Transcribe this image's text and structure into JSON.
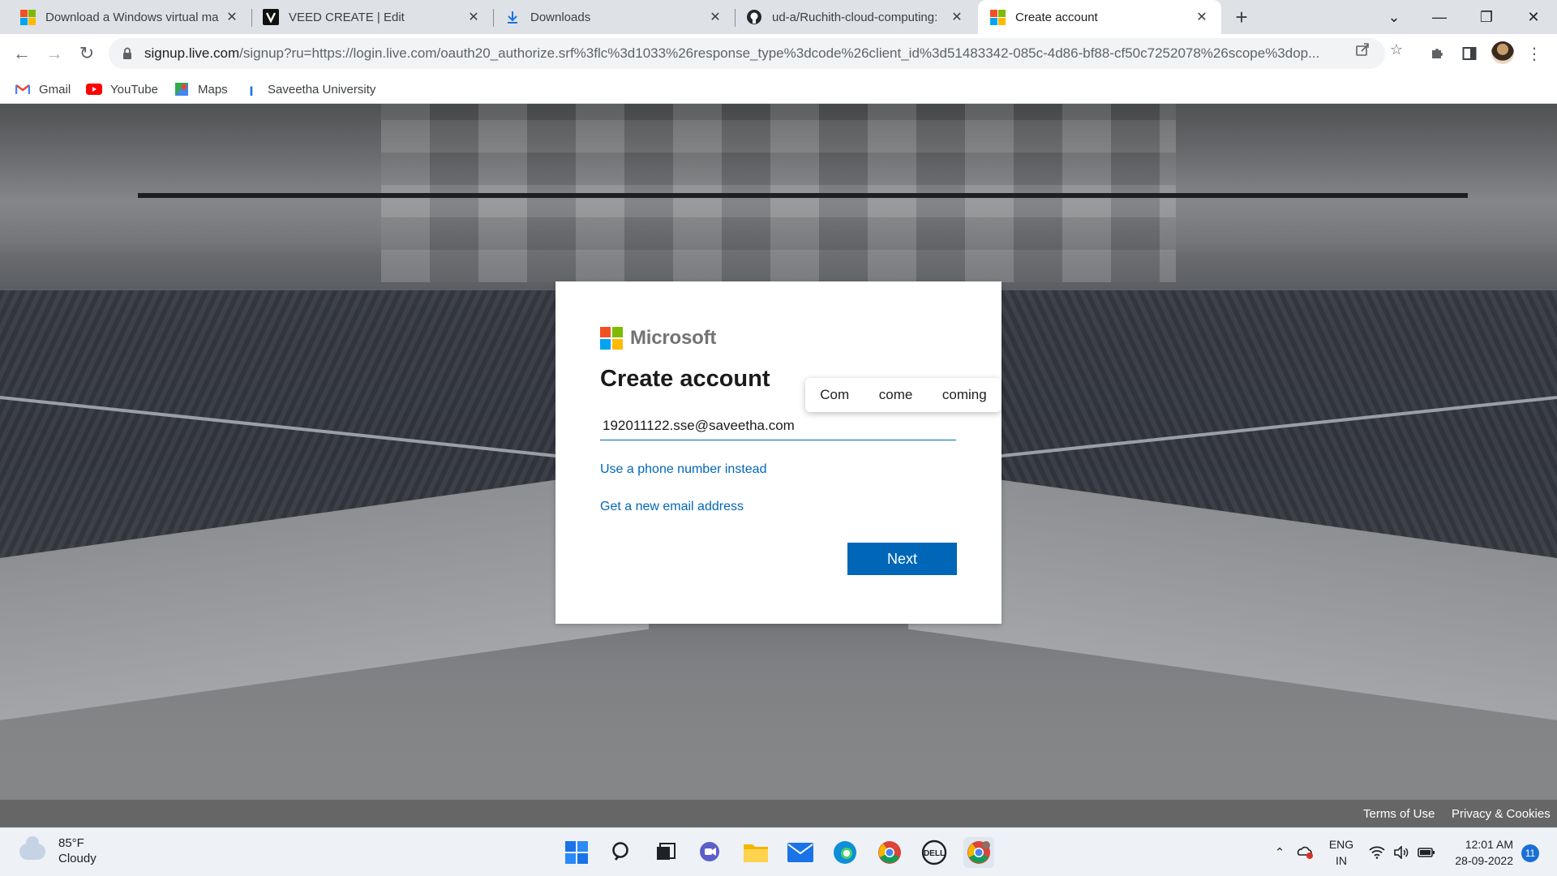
{
  "browser": {
    "tabs": [
      {
        "title": "Download a Windows virtual ma",
        "icon": "windows-logo-icon"
      },
      {
        "title": "VEED CREATE | Edit",
        "icon": "veed-logo-icon"
      },
      {
        "title": "Downloads",
        "icon": "download-icon"
      },
      {
        "title": "ud-a/Ruchith-cloud-computing:",
        "icon": "github-icon"
      },
      {
        "title": "Create account",
        "icon": "microsoft-logo-icon",
        "active": true
      }
    ],
    "url_host": "signup.live.com",
    "url_rest": "/signup?ru=https://login.live.com/oauth20_authorize.srf%3flc%3d1033%26response_type%3dcode%26client_id%3d51483342-085c-4d86-bf88-cf50c7252078%26scope%3dop...",
    "bookmarks": [
      {
        "label": "Gmail"
      },
      {
        "label": "YouTube"
      },
      {
        "label": "Maps"
      },
      {
        "label": "Saveetha University"
      }
    ]
  },
  "card": {
    "brand": "Microsoft",
    "title": "Create account",
    "email_value": "192011122.sse@saveetha.com",
    "phone_link": "Use a phone number instead",
    "new_email_link": "Get a new email address",
    "next_button": "Next"
  },
  "suggestions": [
    "Com",
    "come",
    "coming"
  ],
  "footer": {
    "terms": "Terms of Use",
    "privacy": "Privacy & Cookies"
  },
  "taskbar": {
    "weather_temp": "85°F",
    "weather_condition": "Cloudy",
    "lang_line1": "ENG",
    "lang_line2": "IN",
    "time": "12:01 AM",
    "date": "28-09-2022",
    "notification_count": "11"
  },
  "colors": {
    "ms_blue": "#0067b8",
    "ms_red": "#f25022",
    "ms_green": "#7fba00",
    "ms_blue_logo": "#00a4ef",
    "ms_yellow": "#ffb900"
  }
}
